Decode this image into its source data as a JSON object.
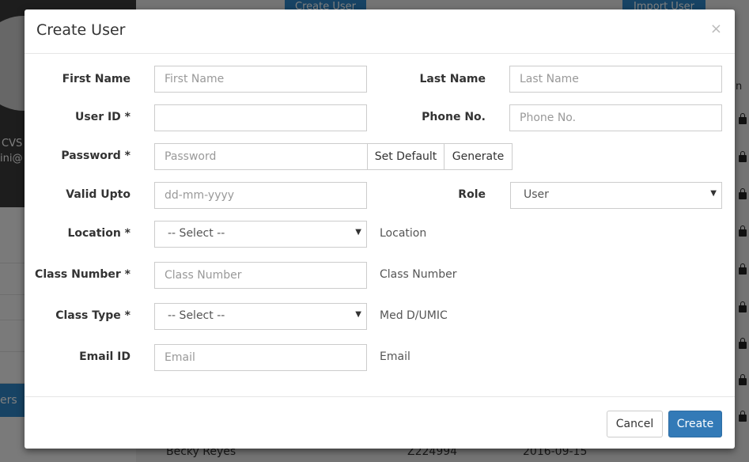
{
  "background": {
    "top_buttons": [
      "Create User",
      "Import User"
    ],
    "profile_name": "CVS",
    "profile_email": "ini@",
    "sidebar_active": "ers",
    "column_header_fragment": "n",
    "row": {
      "name": "Becky Reyes",
      "id": "Z224994",
      "date": "2016-09-15"
    }
  },
  "modal": {
    "title": "Create User",
    "close": "×",
    "fields": {
      "first_name": {
        "label": "First Name",
        "placeholder": "First Name"
      },
      "last_name": {
        "label": "Last Name",
        "placeholder": "Last Name"
      },
      "user_id": {
        "label": "User ID *",
        "placeholder": ""
      },
      "phone": {
        "label": "Phone No.",
        "placeholder": "Phone No."
      },
      "password": {
        "label": "Password *",
        "placeholder": "Password",
        "set_default": "Set Default",
        "generate": "Generate"
      },
      "valid_upto": {
        "label": "Valid Upto",
        "placeholder": "dd-mm-yyyy"
      },
      "role": {
        "label": "Role",
        "value": "User"
      },
      "location": {
        "label": "Location *",
        "value": "-- Select --",
        "hint": "Location"
      },
      "class_number": {
        "label": "Class Number *",
        "placeholder": "Class Number",
        "hint": "Class Number"
      },
      "class_type": {
        "label": "Class Type *",
        "value": "-- Select --",
        "hint": "Med D/UMIC"
      },
      "email": {
        "label": "Email ID",
        "placeholder": "Email",
        "hint": "Email"
      }
    },
    "footer": {
      "cancel": "Cancel",
      "create": "Create"
    }
  }
}
